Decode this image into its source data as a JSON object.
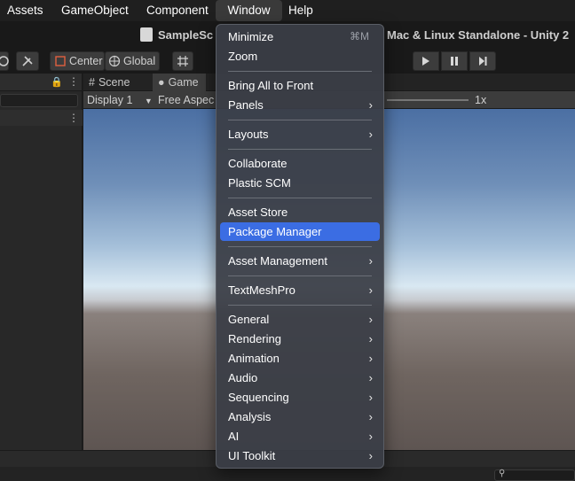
{
  "menubar": {
    "items": [
      "Assets",
      "GameObject",
      "Component",
      "Window",
      "Help"
    ]
  },
  "titlebar": {
    "left_text": "SampleSc",
    "right_text": "Mac & Linux Standalone - Unity 2"
  },
  "toolbar": {
    "center_label": "Center",
    "global_label": "Global"
  },
  "game_view": {
    "tabs": [
      "Scene",
      "Game"
    ],
    "display_label": "Display 1",
    "aspect_label": "Free Aspec",
    "scale_label": "1x"
  },
  "window_menu": {
    "items": [
      {
        "label": "Minimize",
        "shortcut": "⌘M",
        "submenu": false
      },
      {
        "label": "Zoom",
        "shortcut": "",
        "submenu": false
      },
      {
        "label": "Bring All to Front",
        "shortcut": "",
        "submenu": false
      },
      {
        "label": "Panels",
        "shortcut": "",
        "submenu": true
      },
      {
        "label": "Layouts",
        "shortcut": "",
        "submenu": true
      },
      {
        "label": "Collaborate",
        "shortcut": "",
        "submenu": false
      },
      {
        "label": "Plastic SCM",
        "shortcut": "",
        "submenu": false
      },
      {
        "label": "Asset Store",
        "shortcut": "",
        "submenu": false
      },
      {
        "label": "Package Manager",
        "shortcut": "",
        "submenu": false,
        "highlighted": true
      },
      {
        "label": "Asset Management",
        "shortcut": "",
        "submenu": true
      },
      {
        "label": "TextMeshPro",
        "shortcut": "",
        "submenu": true
      },
      {
        "label": "General",
        "shortcut": "",
        "submenu": true
      },
      {
        "label": "Rendering",
        "shortcut": "",
        "submenu": true
      },
      {
        "label": "Animation",
        "shortcut": "",
        "submenu": true
      },
      {
        "label": "Audio",
        "shortcut": "",
        "submenu": true
      },
      {
        "label": "Sequencing",
        "shortcut": "",
        "submenu": true
      },
      {
        "label": "Analysis",
        "shortcut": "",
        "submenu": true
      },
      {
        "label": "AI",
        "shortcut": "",
        "submenu": true
      },
      {
        "label": "UI Toolkit",
        "shortcut": "",
        "submenu": true
      }
    ]
  },
  "colors": {
    "highlight": "#3b6de3",
    "menu_bg": "#3a3e46"
  }
}
